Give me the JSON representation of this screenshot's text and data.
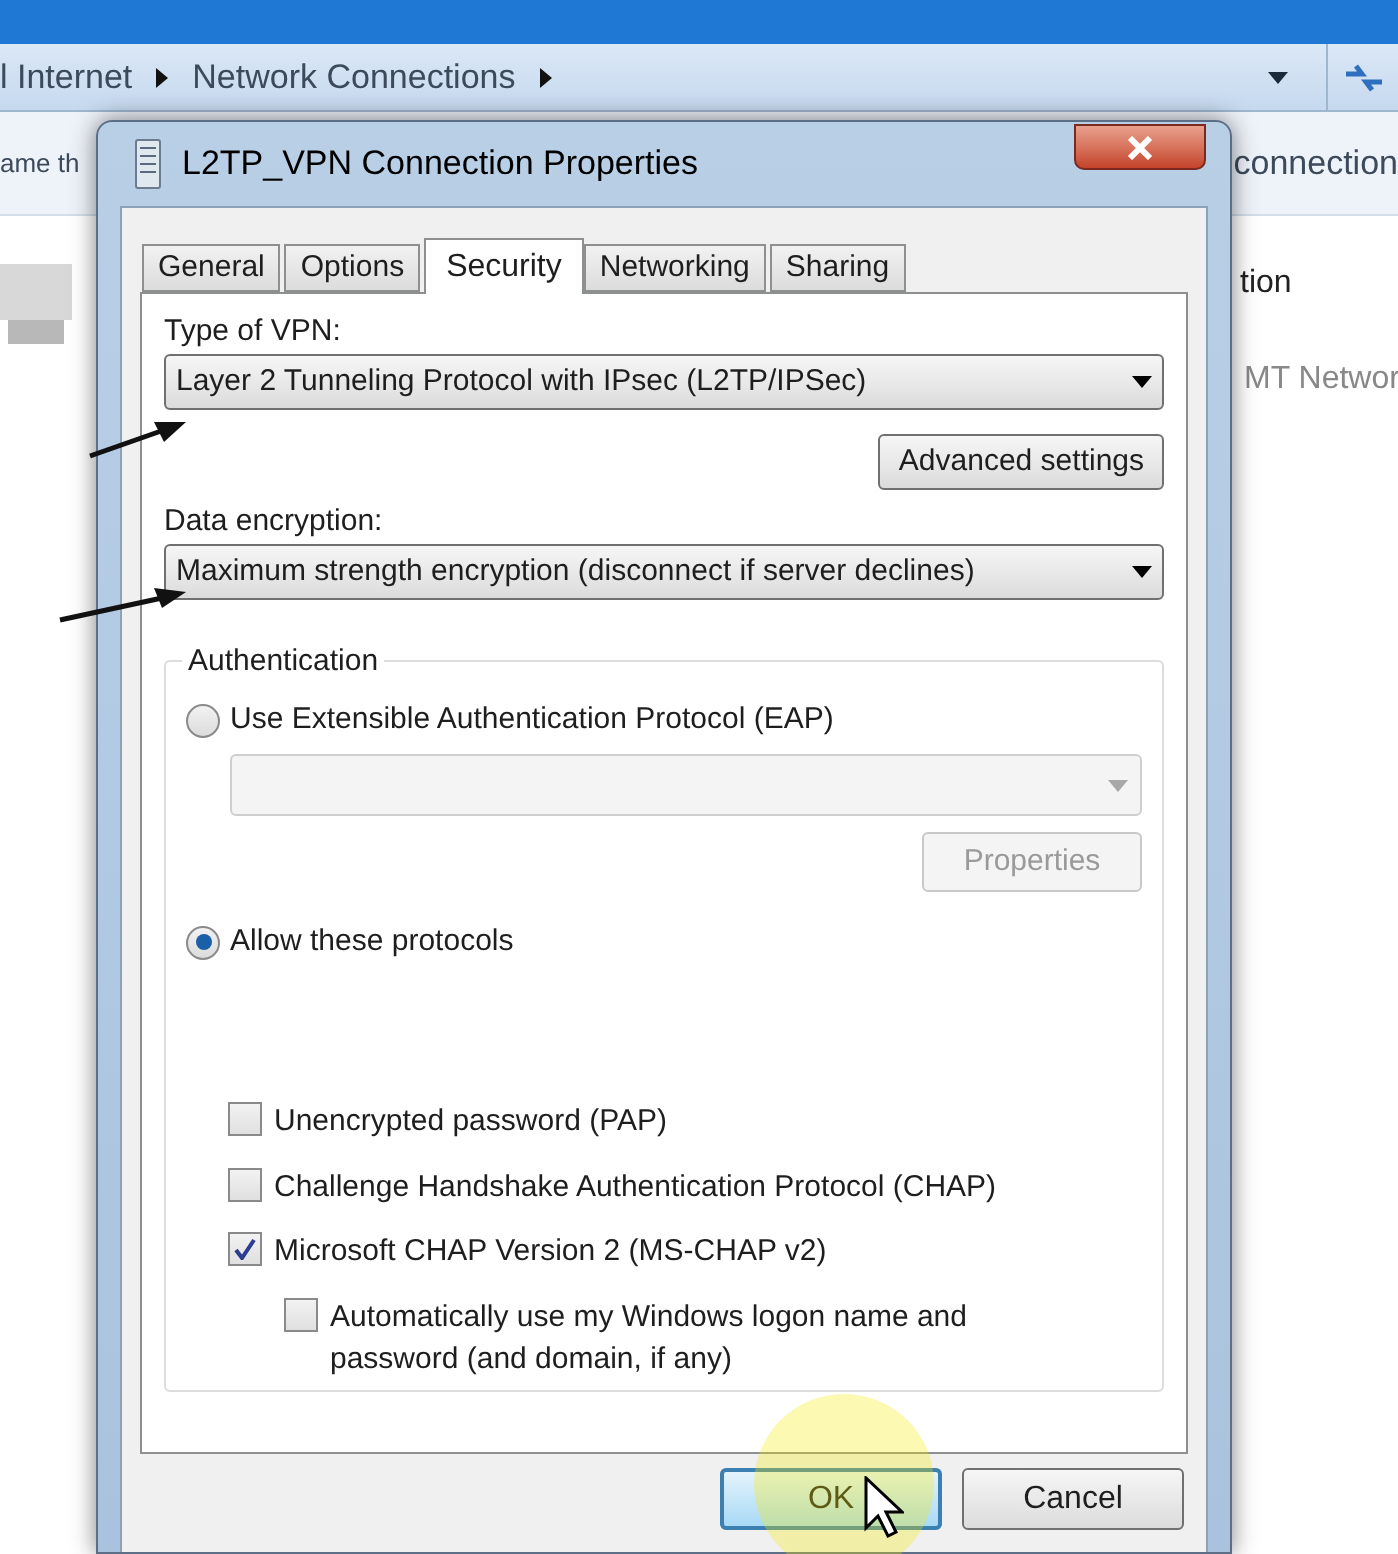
{
  "explorer": {
    "breadcrumbs": [
      "l Internet",
      "Network Connections"
    ],
    "toolbar_left": "ame th",
    "toolbar_right": "connection",
    "content_texts": [
      "tion",
      "MT Networ"
    ]
  },
  "dialog": {
    "title": "L2TP_VPN Connection Properties",
    "tabs": [
      {
        "label": "General",
        "selected": false
      },
      {
        "label": "Options",
        "selected": false
      },
      {
        "label": "Security",
        "selected": true
      },
      {
        "label": "Networking",
        "selected": false
      },
      {
        "label": "Sharing",
        "selected": false
      }
    ],
    "type_of_vpn": {
      "label": "Type of VPN:",
      "value": "Layer 2 Tunneling Protocol with IPsec (L2TP/IPSec)"
    },
    "advanced_button": "Advanced settings",
    "data_encryption": {
      "label": "Data encryption:",
      "value": "Maximum strength encryption (disconnect if server declines)"
    },
    "authentication": {
      "title": "Authentication",
      "eap_option": {
        "label": "Use Extensible Authentication Protocol (EAP)",
        "selected": false
      },
      "eap_method": {
        "disabled": true
      },
      "eap_properties_button": {
        "label": "Properties",
        "disabled": true
      },
      "protocols_option": {
        "label": "Allow these protocols",
        "selected": true
      },
      "protocols": [
        {
          "label": "Unencrypted password (PAP)",
          "checked": false
        },
        {
          "label": "Challenge Handshake Authentication Protocol (CHAP)",
          "checked": false
        },
        {
          "label": "Microsoft CHAP Version 2 (MS-CHAP v2)",
          "checked": true,
          "children": [
            {
              "label": "Automatically use my Windows logon name and password (and domain, if any)",
              "checked": false
            }
          ]
        }
      ]
    },
    "buttons": [
      {
        "label": "OK",
        "default": true
      },
      {
        "label": "Cancel",
        "default": false
      }
    ]
  }
}
